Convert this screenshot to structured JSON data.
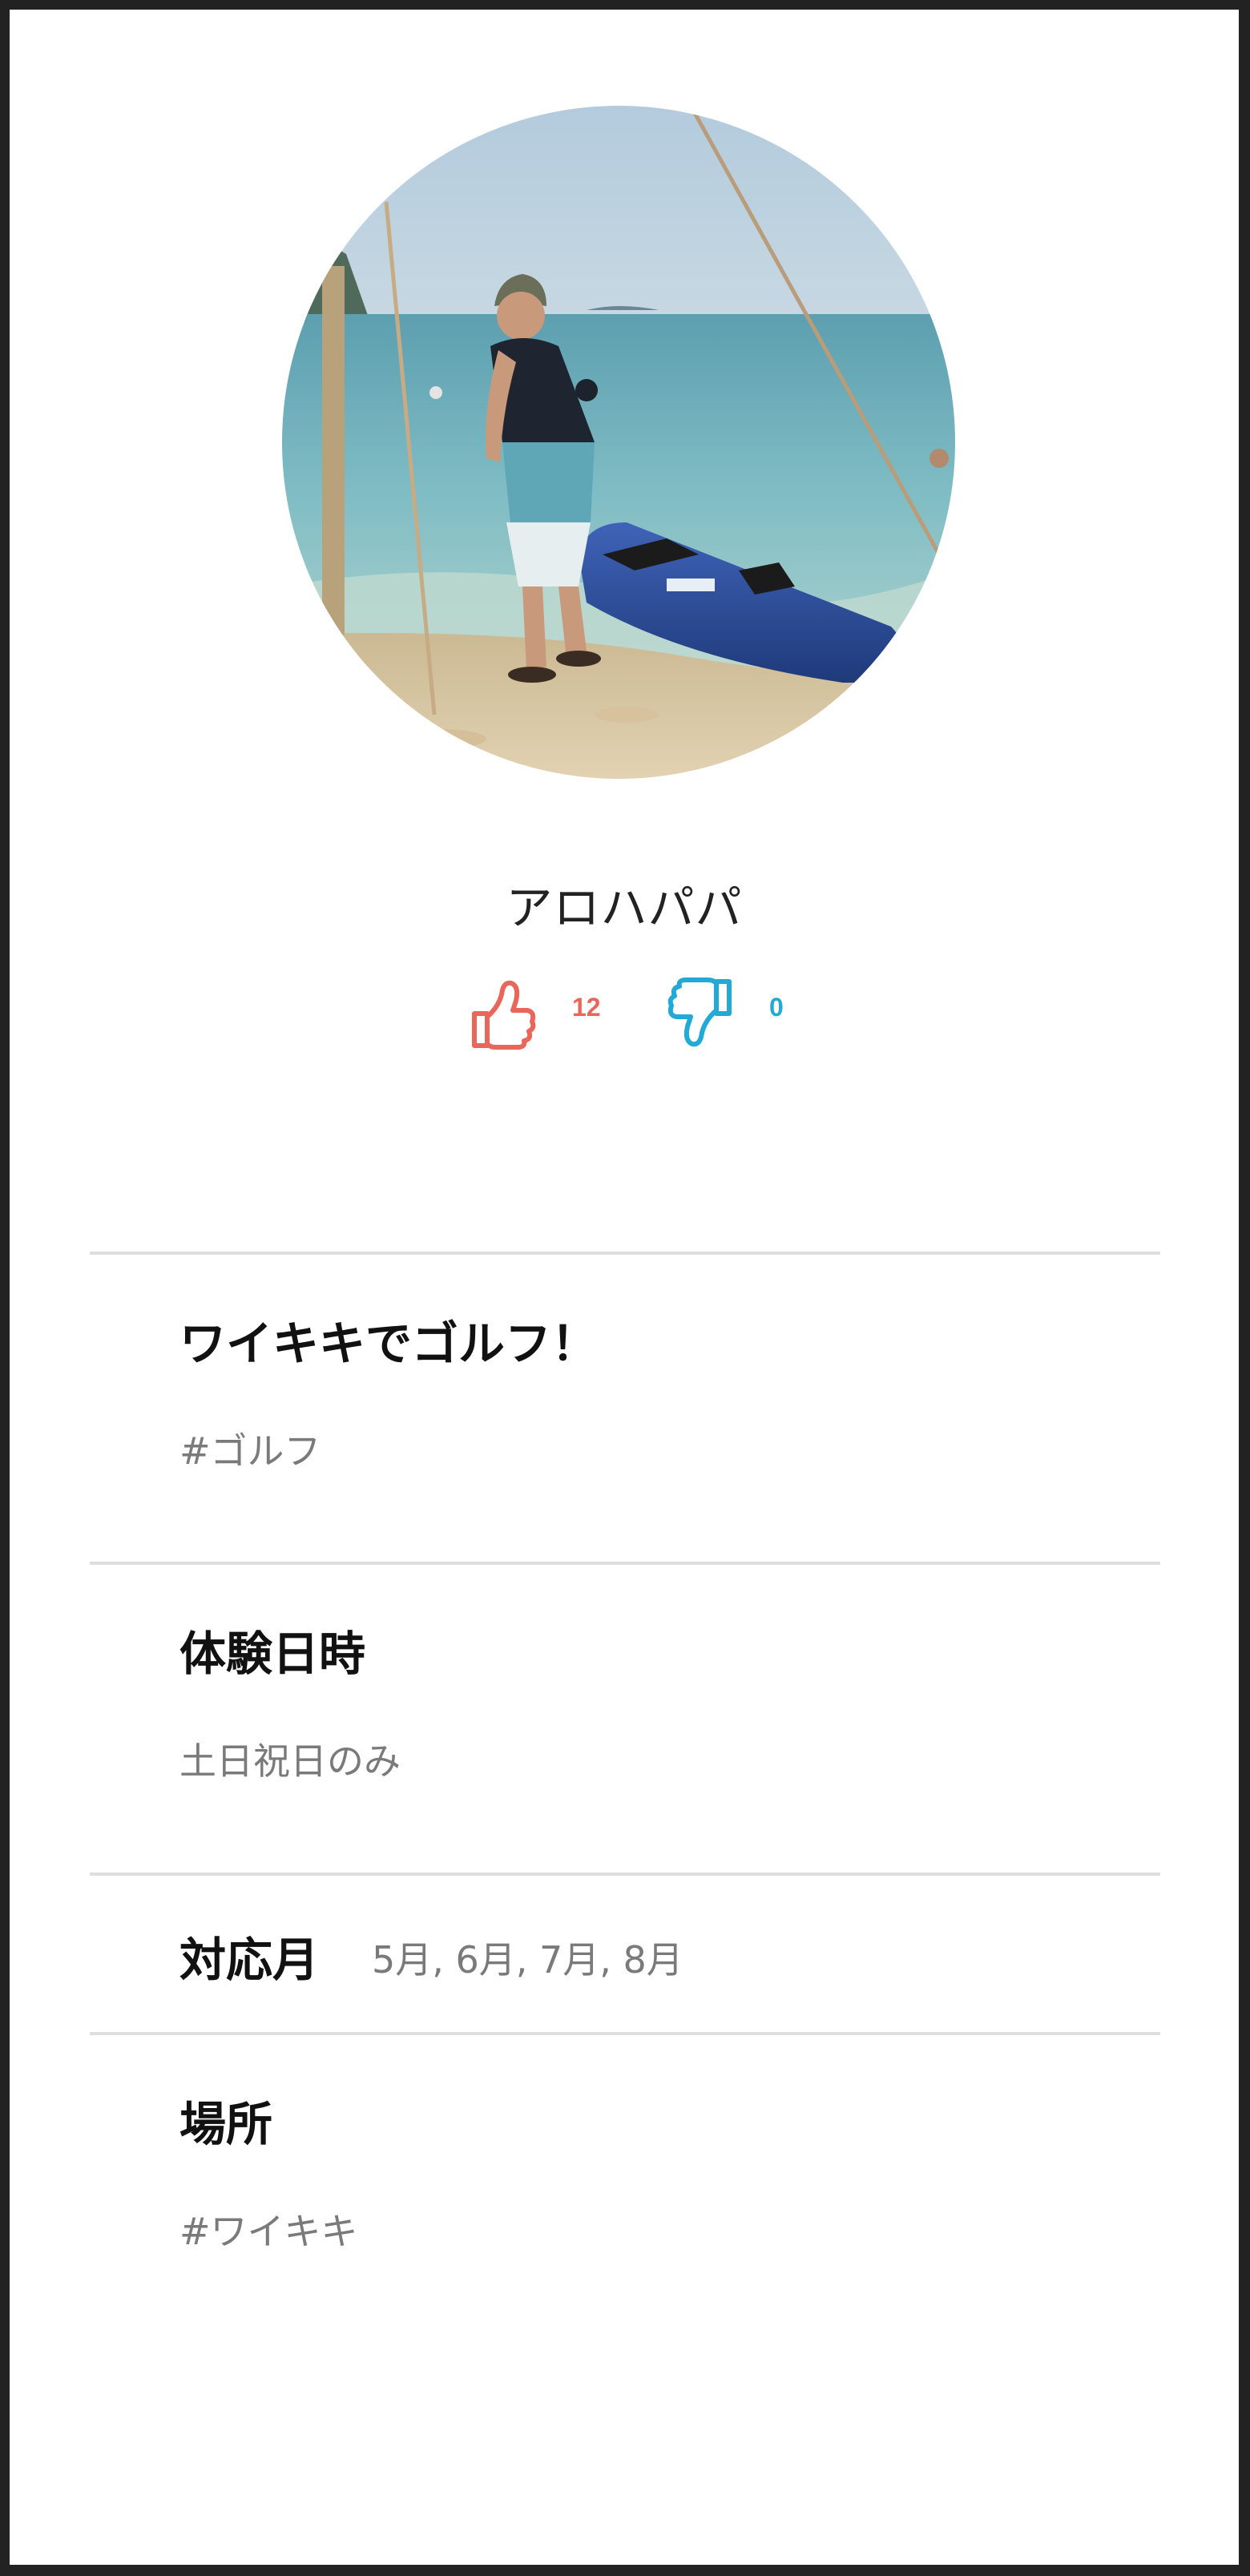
{
  "profile": {
    "name": "アロハパパ",
    "likes": "12",
    "dislikes": "0",
    "like_color": "#e8675a",
    "dislike_color": "#22a9d6"
  },
  "sections": {
    "title": {
      "heading": "ワイキキでゴルフ！",
      "tag": "#ゴルフ"
    },
    "experience_time": {
      "heading": "体験日時",
      "value": "土日祝日のみ"
    },
    "months": {
      "heading": "対応月",
      "value": "5月, 6月, 7月, 8月"
    },
    "place": {
      "heading": "場所",
      "value": "#ワイキキ"
    }
  },
  "icons": {
    "like": "thumbs-up-icon",
    "dislike": "thumbs-down-icon"
  }
}
